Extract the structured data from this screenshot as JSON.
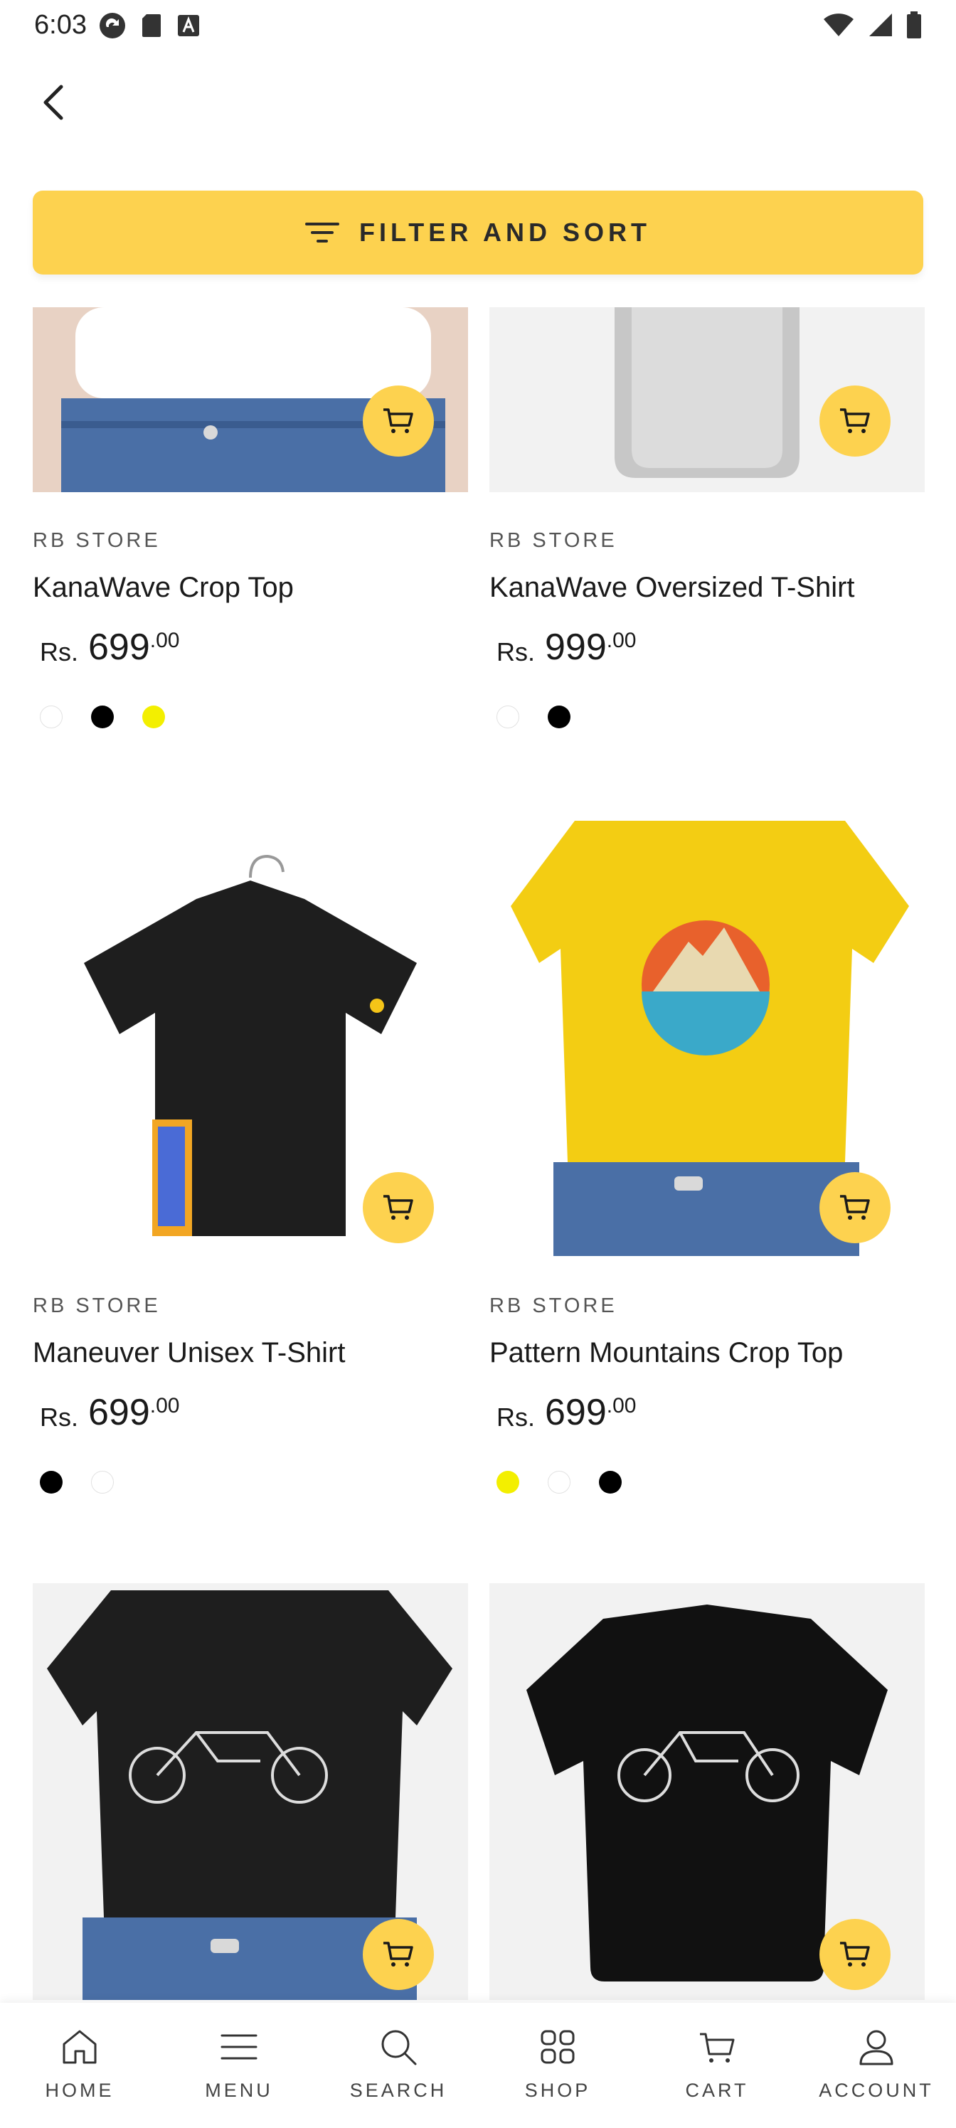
{
  "status_bar": {
    "time": "6:03"
  },
  "filter": {
    "label": "FILTER AND SORT"
  },
  "products": [
    {
      "brand": "RB STORE",
      "name": "KanaWave Crop Top",
      "currency": "Rs.",
      "price": "699",
      "cents": ".00",
      "swatches": [
        "white",
        "black",
        "yellow"
      ],
      "image": "crop-top-white"
    },
    {
      "brand": "RB STORE",
      "name": "KanaWave Oversized T-Shirt",
      "currency": "Rs.",
      "price": "999",
      "cents": ".00",
      "swatches": [
        "white",
        "black"
      ],
      "image": "oversized-tshirt-white"
    },
    {
      "brand": "RB STORE",
      "name": "Maneuver Unisex T-Shirt",
      "currency": "Rs.",
      "price": "699",
      "cents": ".00",
      "swatches": [
        "black",
        "white"
      ],
      "image": "unisex-tshirt-black"
    },
    {
      "brand": "RB STORE",
      "name": "Pattern Mountains Crop Top",
      "currency": "Rs.",
      "price": "699",
      "cents": ".00",
      "swatches": [
        "yellow",
        "white",
        "black"
      ],
      "image": "crop-top-yellow-mountains"
    },
    {
      "image": "crop-top-black-motorcycle"
    },
    {
      "image": "oversized-tshirt-black-motorcycle"
    }
  ],
  "bottom_nav": [
    {
      "label": "HOME",
      "icon": "home-icon"
    },
    {
      "label": "MENU",
      "icon": "menu-icon"
    },
    {
      "label": "SEARCH",
      "icon": "search-icon"
    },
    {
      "label": "SHOP",
      "icon": "grid-icon"
    },
    {
      "label": "CART",
      "icon": "cart-icon"
    },
    {
      "label": "ACCOUNT",
      "icon": "user-icon"
    }
  ],
  "colors": {
    "accent": "#fdd24f",
    "swatch_yellow": "#f3ef00",
    "swatch_black": "#000000",
    "swatch_white": "#ffffff"
  }
}
